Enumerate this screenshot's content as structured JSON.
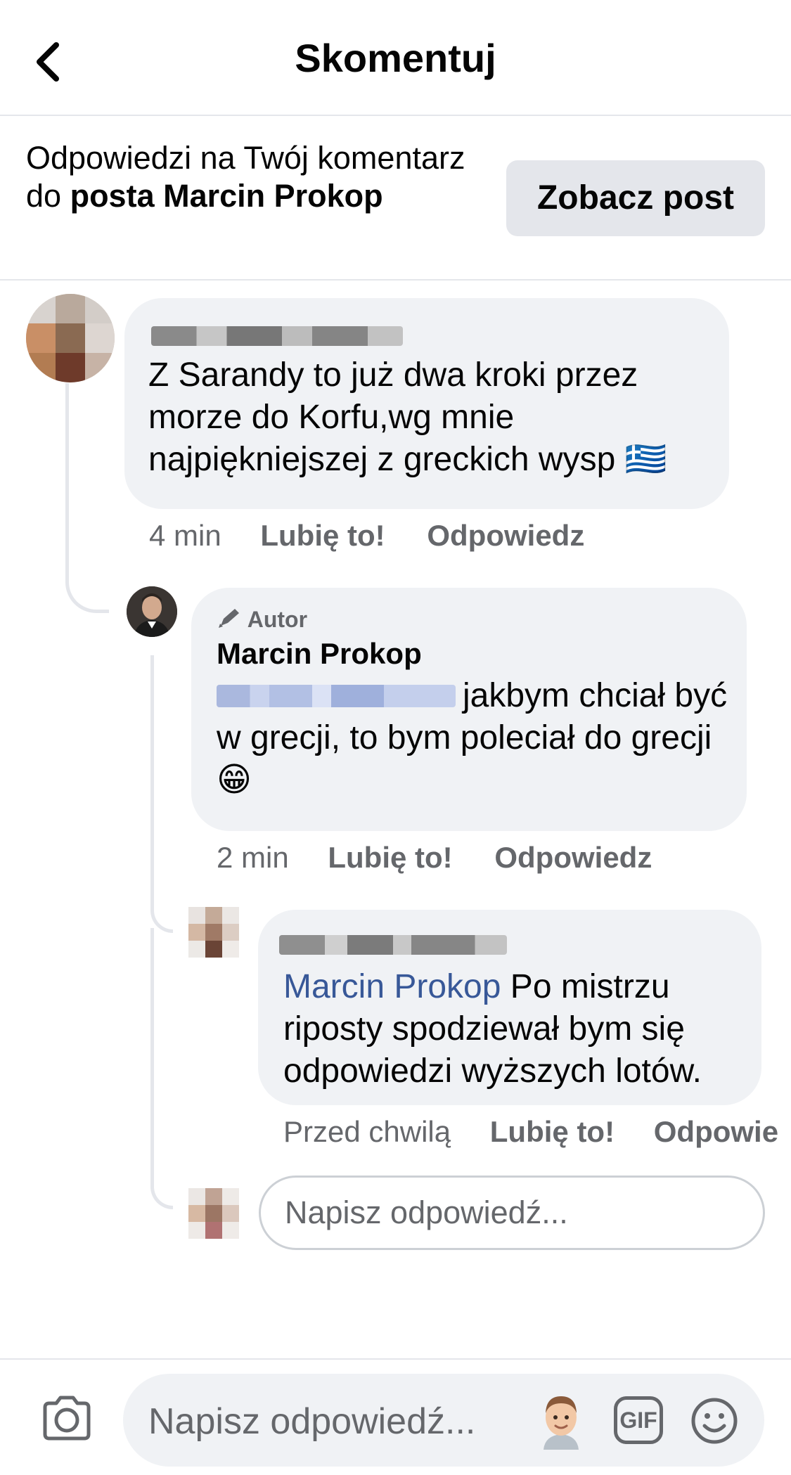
{
  "header": {
    "title": "Skomentuj",
    "back_icon": "chevron-left-icon"
  },
  "context": {
    "text_prefix": "Odpowiedzi na Twój komentarz do",
    "text_bold": "posta Marcin Prokop",
    "see_post_label": "Zobacz post"
  },
  "comments": [
    {
      "text": "Z Sarandy to już dwa kroki przez morze do Korfu,wg mnie najpiękniejszej z greckich wysp",
      "emoji": "🇬🇷",
      "time": "4 min",
      "like": "Lubię to!",
      "reply": "Odpowiedz"
    },
    {
      "badge": "Autor",
      "author": "Marcin Prokop",
      "text": "jakbym chciał być w grecji, to bym poleciał do grecji",
      "emoji": "😁",
      "time": "2 min",
      "like": "Lubię to!",
      "reply": "Odpowiedz"
    },
    {
      "mention": "Marcin Prokop",
      "text": "Po mistrzu riposty spodziewał bym się odpowiedzi wyższych lotów.",
      "time": "Przed chwilą",
      "like": "Lubię to!",
      "reply": "Odpowie"
    }
  ],
  "reply_field": {
    "placeholder": "Napisz odpowiedź..."
  },
  "composer": {
    "placeholder": "Napisz odpowiedź...",
    "camera_icon": "camera-icon",
    "avatar_icon": "avatar-sticker-icon",
    "gif_label": "GIF",
    "emoji_icon": "smiley-icon"
  },
  "colors": {
    "bubble": "#f0f2f5",
    "mention": "#385898",
    "muted": "#65676b",
    "divider": "#e4e6eb"
  }
}
